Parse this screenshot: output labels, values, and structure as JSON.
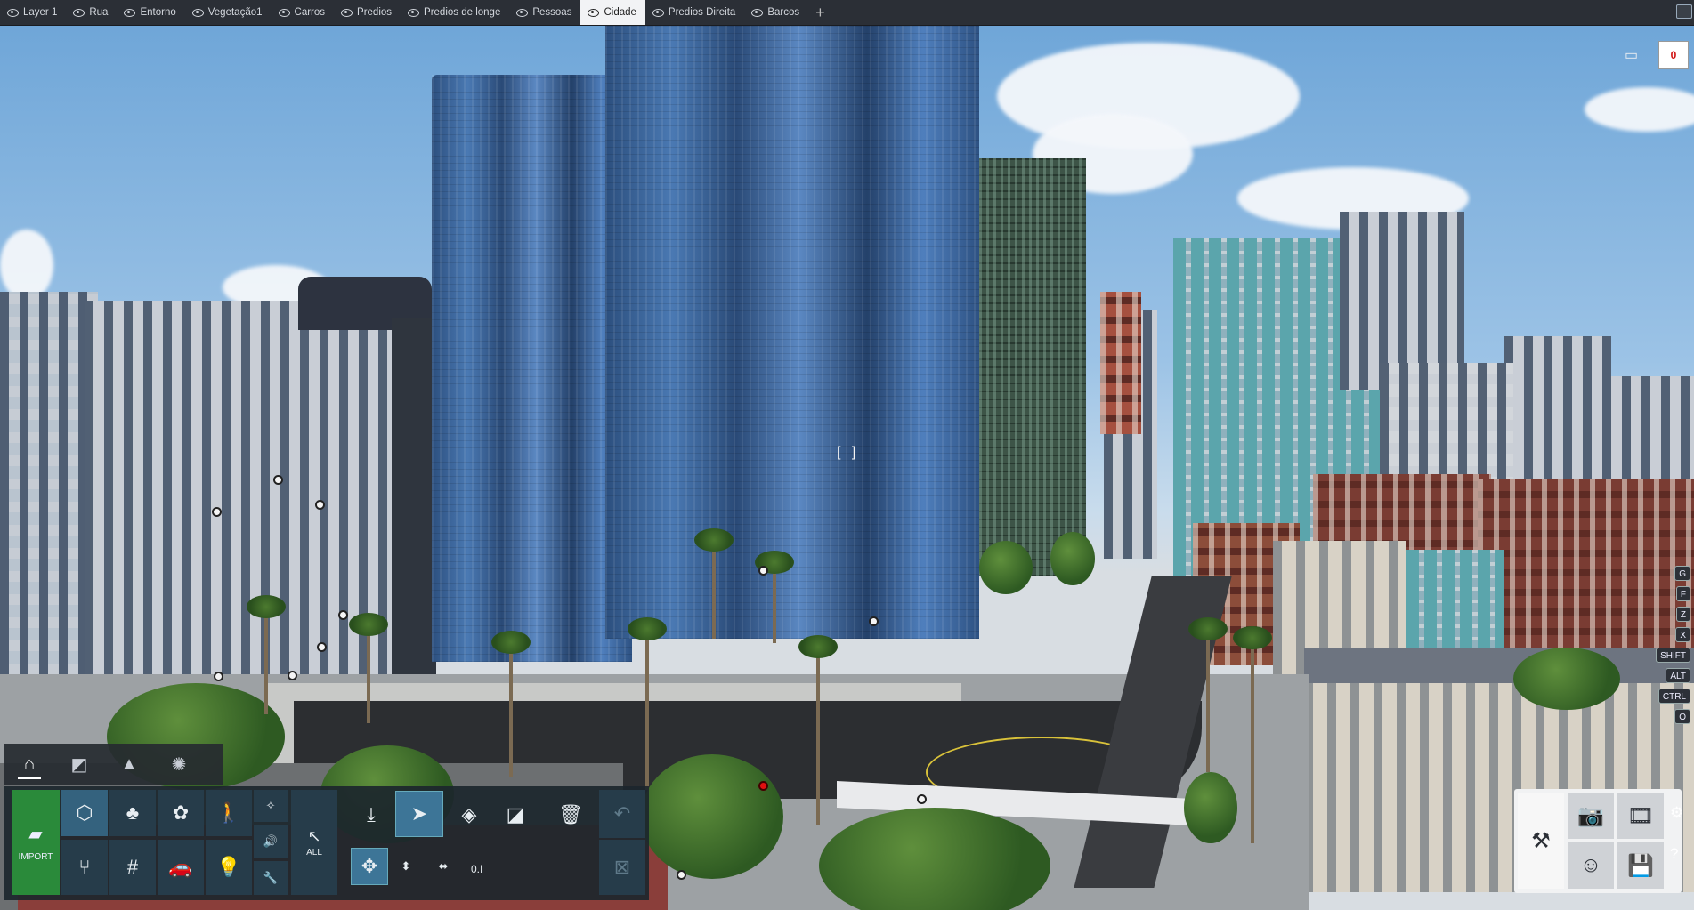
{
  "layers": [
    {
      "label": "Layer 1",
      "active": false
    },
    {
      "label": "Rua",
      "active": false
    },
    {
      "label": "Entorno",
      "active": false
    },
    {
      "label": "Vegetação1",
      "active": false
    },
    {
      "label": "Carros",
      "active": false
    },
    {
      "label": "Predios",
      "active": false
    },
    {
      "label": "Predios de longe",
      "active": false
    },
    {
      "label": "Pessoas",
      "active": false
    },
    {
      "label": "Cidade",
      "active": true
    },
    {
      "label": "Predios Direita",
      "active": false
    },
    {
      "label": "Barcos",
      "active": false
    }
  ],
  "add_layer_label": "+",
  "counter": "0",
  "crosshair": "[ ]",
  "shortcut_keys": [
    "G",
    "F",
    "Z",
    "X",
    "SHIFT",
    "ALT",
    "CTRL",
    "O"
  ],
  "toolbox": {
    "categories": [
      {
        "icon": "home-icon",
        "glyph": "⌂"
      },
      {
        "icon": "material-icon",
        "glyph": "◩"
      },
      {
        "icon": "terrain-icon",
        "glyph": "▲"
      },
      {
        "icon": "sun-icon",
        "glyph": "✺"
      }
    ],
    "import_label": "IMPORT",
    "import_glyph": "▰",
    "all_label": "ALL",
    "tile_glyphs": {
      "buildings": "⬡",
      "tree": "♣",
      "add_tree": "✿",
      "person": "🚶",
      "wand": "✧",
      "sound": "🔊",
      "chair": "⑂",
      "fence": "#",
      "car": "🚗",
      "light": "💡",
      "wrench": "🔧",
      "all_arrow": "↖",
      "drop": "⤓",
      "select": "➤",
      "rotate": "◈",
      "scale": "◪",
      "delete": "🗑",
      "undo": "↶",
      "move": "✥",
      "updown": "⬍",
      "leftright": "⬌",
      "deselect": "⊠"
    },
    "value_text": "0.I"
  },
  "right_panel": {
    "glyphs": {
      "worker": "⚒",
      "camera": "📷",
      "film": "🎞",
      "avatar": "☺",
      "save": "💾"
    },
    "side_glyphs": {
      "settings": "⚙",
      "help": "?"
    }
  },
  "colors": {
    "topbar": "#2b2f36",
    "active_tab": "#f2f3f5",
    "import_green": "#2a8a3a",
    "tile_blue": "#34627e",
    "counter_red": "#d01010"
  }
}
